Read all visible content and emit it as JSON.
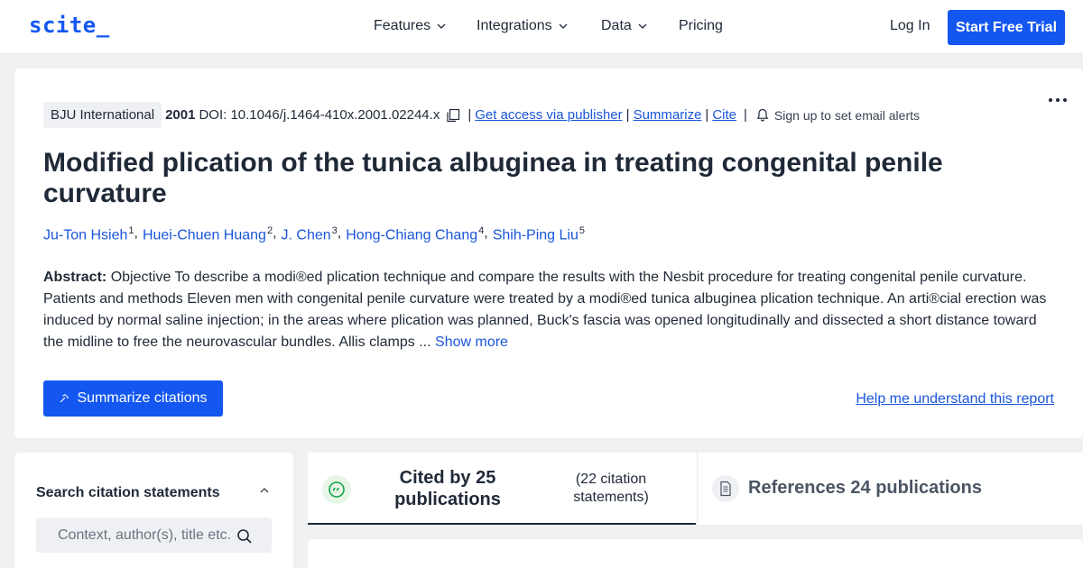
{
  "nav": {
    "logo": "scite_",
    "items": [
      {
        "label": "Features",
        "has_dropdown": true
      },
      {
        "label": "Integrations",
        "has_dropdown": true
      },
      {
        "label": "Data",
        "has_dropdown": true
      },
      {
        "label": "Pricing",
        "has_dropdown": false
      }
    ],
    "login": "Log In",
    "cta": "Start Free Trial"
  },
  "paper": {
    "journal": "BJU International",
    "year": "2001",
    "doi": "DOI: 10.1046/j.1464-410x.2001.02244.x",
    "links": {
      "access": "Get access via publisher",
      "summarize": "Summarize",
      "cite": "Cite"
    },
    "alerts": "Sign up to set email alerts",
    "title": "Modified plication of the tunica albuginea in treating congenital penile curvature",
    "authors": [
      {
        "name": "Ju-Ton Hsieh",
        "sup": "1"
      },
      {
        "name": "Huei-Chuen Huang",
        "sup": "2"
      },
      {
        "name": "J. Chen",
        "sup": "3"
      },
      {
        "name": "Hong-Chiang Chang",
        "sup": "4"
      },
      {
        "name": "Shih-Ping Liu",
        "sup": "5"
      }
    ],
    "abstract_label": "Abstract:",
    "abstract_text": "Objective To describe a modi®ed plication technique and compare the results with the Nesbit procedure for treating congenital penile curvature. Patients and methods Eleven men with congenital penile curvature were treated by a modi®ed tunica albuginea plication technique. An arti®cial erection was induced by normal saline injection; in the areas where plication was planned, Buck's fascia was opened longitudinally and dissected a short distance toward the midline to free the neurovascular bundles. Allis clamps ...",
    "show_more": "Show more",
    "summarize_button": "Summarize citations",
    "help_link": "Help me understand this report"
  },
  "search_panel": {
    "title": "Search citation statements",
    "placeholder": "Context, author(s), title etc."
  },
  "tabs": {
    "cited_by": "Cited by 25 publications",
    "cited_statements": "(22 citation statements)",
    "references": "References 24 publications"
  },
  "colors": {
    "brand": "#1357f0",
    "link": "#1a56db",
    "background": "#f0f1f3"
  }
}
